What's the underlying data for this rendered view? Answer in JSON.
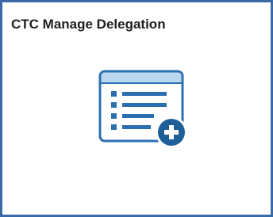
{
  "tile": {
    "title": "CTC Manage Delegation",
    "icon": "list-add-icon",
    "colors": {
      "border": "#3a69a8",
      "icon_light": "#bcd8f0",
      "icon_dark": "#2a6fb0",
      "badge": "#1d5f96"
    }
  }
}
